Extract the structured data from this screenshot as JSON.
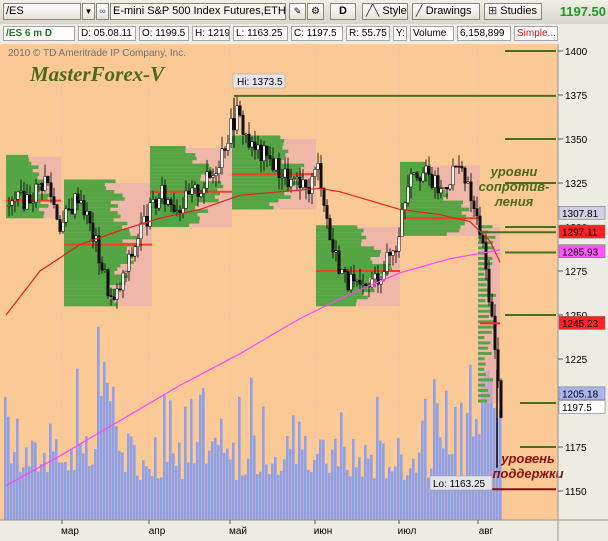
{
  "toolbar": {
    "symbol": "/ES",
    "description": "E-mini S&P 500 Index Futures,ETH",
    "d_label": "D",
    "style_label": "Style",
    "drawings_label": "Drawings",
    "studies_label": "Studies",
    "last_price": "1197.50"
  },
  "infobar": {
    "timeframe": "/ES 6 m D",
    "date": "D: 05.08.11",
    "open": "O: 1199.5",
    "high": "H: 1219",
    "low": "L: 1163.25",
    "close": "C: 1197.5",
    "range": "R: 55.75",
    "y": "Y:",
    "volume_label": "Volume",
    "volume_value": "6,158,899",
    "simple": "Simple..."
  },
  "chart": {
    "copyright": "2010 © TD Ameritrade IP Company, Inc.",
    "watermark": "MasterForex-V",
    "hi_label": "Hi: 1373.5",
    "lo_label": "Lo: 1163.25",
    "resistance_note": [
      "уровни",
      "сопротив-",
      "ления"
    ],
    "support_note": [
      "уровень",
      "поддержки"
    ],
    "colors": {
      "background": "#fbc996",
      "volume": "#8fa0e6",
      "profile_green": "#55a544",
      "profile_pink": "#e6a8b8",
      "ma_red": "#e2231a",
      "ma_magenta": "#ff44ff",
      "level_line": "#4b6e1e"
    }
  },
  "axis": {
    "y_ticks": [
      "1400",
      "1375",
      "1350",
      "1325",
      "1300",
      "1275",
      "1250",
      "1225",
      "1200",
      "1175",
      "1150"
    ],
    "x_ticks": [
      "мар",
      "апр",
      "май",
      "июн",
      "июл",
      "авг"
    ]
  },
  "price_tags": [
    {
      "value": 1307.81,
      "text": "1307.81",
      "bg": "#cfcfe6",
      "fg": "#000000"
    },
    {
      "value": 1297.11,
      "text": "1297.11",
      "bg": "#ff2222",
      "fg": "#000000"
    },
    {
      "value": 1285.93,
      "text": "1285.93",
      "bg": "#ff55ff",
      "fg": "#000000"
    },
    {
      "value": 1245.23,
      "text": "1245.23",
      "bg": "#ff2222",
      "fg": "#000000"
    },
    {
      "value": 1205.18,
      "text": "1205.18",
      "bg": "#a9b4ee",
      "fg": "#000000"
    },
    {
      "value": 1197.5,
      "text": "1197.5",
      "bg": "#ffffff",
      "fg": "#000000"
    }
  ]
}
